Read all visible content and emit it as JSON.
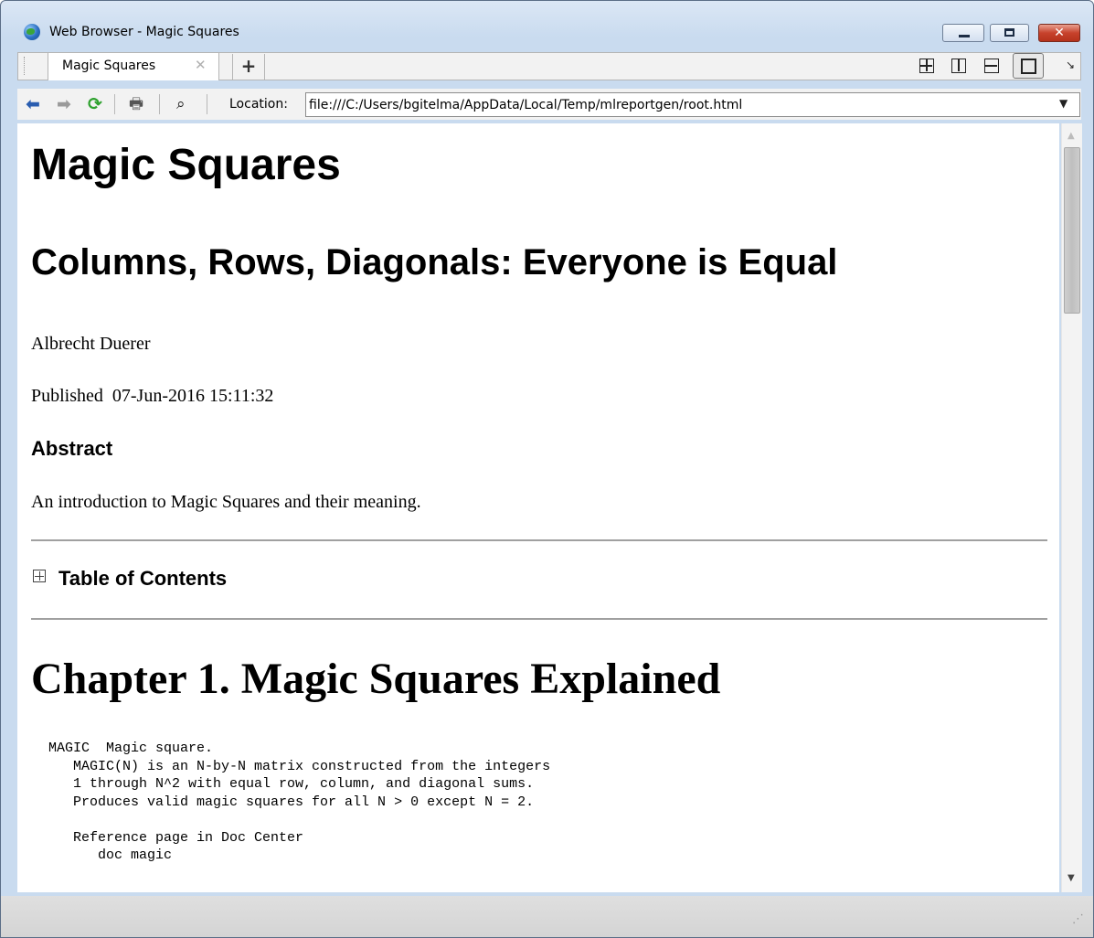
{
  "window": {
    "title": "Web Browser - Magic Squares",
    "buttons": {
      "minimize": "–",
      "maximize": "□",
      "close": "✕"
    }
  },
  "tabs": {
    "items": [
      {
        "label": "Magic Squares",
        "close": "✕"
      }
    ],
    "new_tab": "+",
    "layout_icons": [
      "tile-grid-icon",
      "split-vertical-icon",
      "split-horizontal-icon",
      "single-view-icon"
    ],
    "dock_glyph": "↘"
  },
  "toolbar": {
    "icons": [
      "back-arrow-icon",
      "forward-arrow-icon",
      "refresh-icon",
      "print-icon",
      "find-icon"
    ],
    "back": "⬅",
    "forward": "➡",
    "refresh": "⟳",
    "print": "🖶",
    "find": "⌕",
    "location_label": "Location:",
    "location_value": "file:///C:/Users/bgitelma/AppData/Local/Temp/mlreportgen/root.html",
    "dropdown": "▼"
  },
  "document": {
    "title": "Magic Squares",
    "subtitle": "Columns, Rows, Diagonals: Everyone is Equal",
    "author": "Albrecht Duerer",
    "published": "Published  07-Jun-2016 15:11:32",
    "abstract_heading": "Abstract",
    "abstract_text": "An introduction to Magic Squares and their meaning.",
    "toc_label": "Table of Contents",
    "chapter_title": "Chapter 1. Magic Squares Explained",
    "code": " MAGIC  Magic square.\n    MAGIC(N) is an N-by-N matrix constructed from the integers\n    1 through N^2 with equal row, column, and diagonal sums.\n    Produces valid magic squares for all N > 0 except N = 2.\n\n    Reference page in Doc Center\n       doc magic"
  },
  "scrollbar": {
    "up": "▲",
    "down": "▼"
  },
  "statusbar": {
    "grip": "⋰"
  },
  "colors": {
    "frame": "#c9dbef",
    "close_button": "#c7422c",
    "refresh_green": "#2ea12e",
    "back_blue": "#2a5db0"
  }
}
